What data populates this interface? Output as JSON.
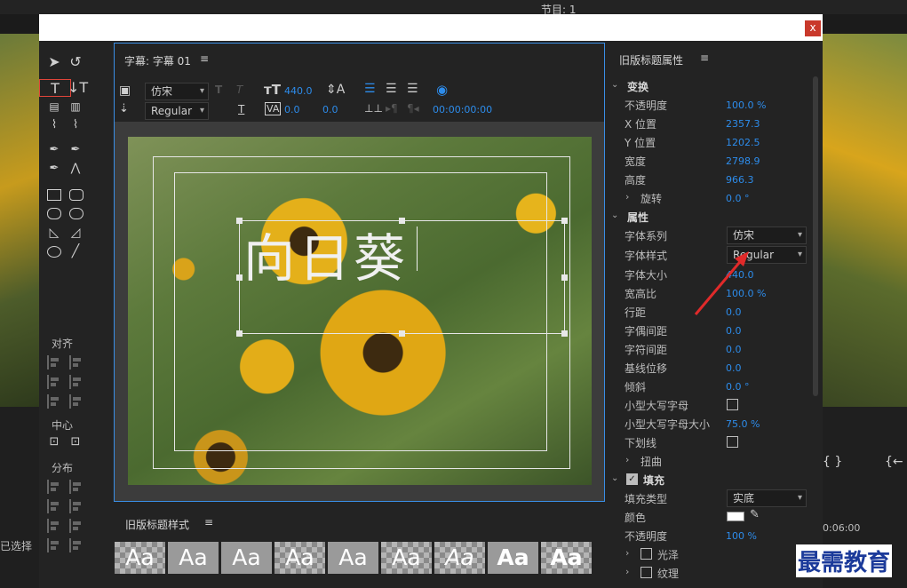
{
  "background": {
    "top_label": "节目: 1",
    "left_status": "已选择"
  },
  "window": {
    "close_label": "x"
  },
  "tools_panel": {
    "align_title": "对齐",
    "center_title": "中心",
    "distribute_title": "分布"
  },
  "editor": {
    "title": "字幕: 字幕 01",
    "menu_glyph": "≡",
    "font_family": "仿宋",
    "font_style": "Regular",
    "font_size": "440.0",
    "kerning": "0.0",
    "leading": "0.0",
    "timecode": "00:00:00:00",
    "title_text": "向日葵"
  },
  "styles_panel": {
    "title": "旧版标题样式",
    "swatch_label": "Aa"
  },
  "properties": {
    "title": "旧版标题属性",
    "transform": {
      "label": "变换",
      "rows": [
        {
          "label": "不透明度",
          "value": "100.0 %"
        },
        {
          "label": "X 位置",
          "value": "2357.3"
        },
        {
          "label": "Y 位置",
          "value": "1202.5"
        },
        {
          "label": "宽度",
          "value": "2798.9"
        },
        {
          "label": "高度",
          "value": "966.3"
        },
        {
          "label": "旋转",
          "value": "0.0 °"
        }
      ]
    },
    "attributes": {
      "label": "属性",
      "font_family_label": "字体系列",
      "font_family_value": "仿宋",
      "font_style_label": "字体样式",
      "font_style_value": "Regular",
      "rows": [
        {
          "label": "字体大小",
          "value": "440.0"
        },
        {
          "label": "宽高比",
          "value": "100.0 %"
        },
        {
          "label": "行距",
          "value": "0.0"
        },
        {
          "label": "字偶间距",
          "value": "0.0"
        },
        {
          "label": "字符间距",
          "value": "0.0"
        },
        {
          "label": "基线位移",
          "value": "0.0"
        },
        {
          "label": "倾斜",
          "value": "0.0 °"
        }
      ],
      "small_caps_label": "小型大写字母",
      "small_caps_size_label": "小型大写字母大小",
      "small_caps_size_value": "75.0 %",
      "underline_label": "下划线",
      "distort_label": "扭曲"
    },
    "fill": {
      "label": "填充",
      "fill_type_label": "填充类型",
      "fill_type_value": "实底",
      "color_label": "颜色",
      "color_value": "#ffffff",
      "opacity_label": "不透明度",
      "opacity_value": "100 %",
      "gloss_label": "光泽",
      "texture_label": "纹理"
    }
  },
  "watermark": "最需教育"
}
